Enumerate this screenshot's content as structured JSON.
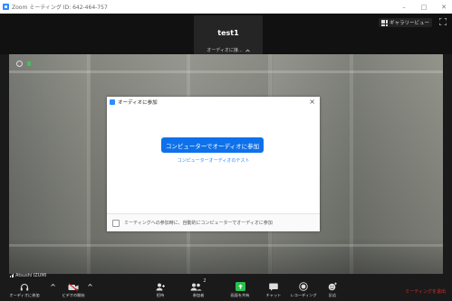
{
  "window": {
    "title": "Zoom ミーティング ID: 642-464-757",
    "controls": [
      "–",
      "□",
      "✕"
    ]
  },
  "top": {
    "gallery_label": "ギャラリービュー",
    "participant_name": "test1",
    "participant_audio_label": "オーディオに接...",
    "fullscreen_icon": "fullscreen-icon"
  },
  "video": {
    "active_speaker_name": "Atsushi IZUMI"
  },
  "dialog": {
    "title": "オーディオに参加",
    "close_label": "×",
    "join_button_label": "コンピューターでオーディオに参加",
    "test_link_label": "コンピューターオーディオのテスト",
    "auto_join_checkbox_label": "ミーティングへの参加時に、自動的にコンピューターでオーディオに参加",
    "auto_join_checked": false
  },
  "toolbar": {
    "items": [
      {
        "id": "join-audio",
        "label": "オーディオに参加",
        "icon": "headphones-icon"
      },
      {
        "id": "start-video",
        "label": "ビデオの開始",
        "icon": "video-off-icon"
      },
      {
        "id": "invite",
        "label": "招待",
        "icon": "add-user-icon"
      },
      {
        "id": "participants",
        "label": "参加者",
        "icon": "participants-icon",
        "count": "2"
      },
      {
        "id": "share-screen",
        "label": "画面を共有",
        "icon": "share-screen-icon"
      },
      {
        "id": "chat",
        "label": "チャット",
        "icon": "chat-icon"
      },
      {
        "id": "record",
        "label": "レコーディング",
        "icon": "record-icon"
      },
      {
        "id": "reactions",
        "label": "反応",
        "icon": "reactions-icon"
      }
    ],
    "leave_label": "ミーティングを退出"
  },
  "colors": {
    "accent": "#0e71eb",
    "share_green": "#27c24c",
    "leave_red": "#e02828",
    "video_off_red": "#e02828"
  }
}
